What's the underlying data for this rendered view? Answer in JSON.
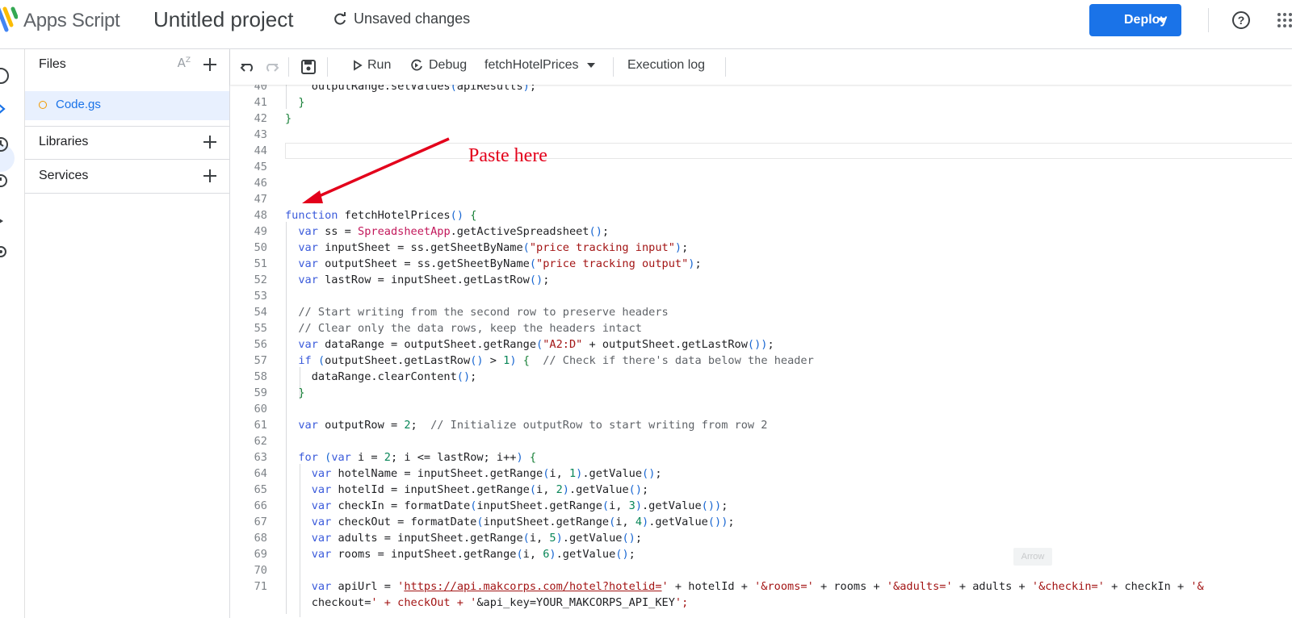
{
  "header": {
    "app_name": "Apps Script",
    "project_title": "Untitled project",
    "save_status": "Unsaved changes",
    "deploy_label": "Deploy",
    "accent_color": "#1a73e8"
  },
  "rail": {
    "icons": [
      "info-icon",
      "code-icon",
      "clock-history-icon",
      "alarm-icon",
      "executions-icon",
      "settings-icon"
    ]
  },
  "files_panel": {
    "files_label": "Files",
    "files": [
      {
        "name": "Code.gs",
        "active": true
      }
    ],
    "libraries_label": "Libraries",
    "services_label": "Services"
  },
  "toolbar": {
    "run_label": "Run",
    "debug_label": "Debug",
    "function_select": "fetchHotelPrices",
    "execution_log_label": "Execution log"
  },
  "annotation": {
    "text": "Paste here",
    "color": "#e3001b"
  },
  "tooltip": "Arrow",
  "editor": {
    "lines": [
      {
        "n": "40",
        "code": "    outputRange.setValues(apiResults);"
      },
      {
        "n": "41",
        "code": "  }"
      },
      {
        "n": "42",
        "code": "}"
      },
      {
        "n": "43",
        "code": ""
      },
      {
        "n": "44",
        "code": ""
      },
      {
        "n": "45",
        "code": ""
      },
      {
        "n": "46",
        "code": ""
      },
      {
        "n": "47",
        "code": ""
      },
      {
        "n": "48",
        "code": "function fetchHotelPrices() {"
      },
      {
        "n": "49",
        "code": "  var ss = SpreadsheetApp.getActiveSpreadsheet();"
      },
      {
        "n": "50",
        "code": "  var inputSheet = ss.getSheetByName(\"price tracking input\");"
      },
      {
        "n": "51",
        "code": "  var outputSheet = ss.getSheetByName(\"price tracking output\");"
      },
      {
        "n": "52",
        "code": "  var lastRow = inputSheet.getLastRow();"
      },
      {
        "n": "53",
        "code": ""
      },
      {
        "n": "54",
        "code": "  // Start writing from the second row to preserve headers"
      },
      {
        "n": "55",
        "code": "  // Clear only the data rows, keep the headers intact"
      },
      {
        "n": "56",
        "code": "  var dataRange = outputSheet.getRange(\"A2:D\" + outputSheet.getLastRow());"
      },
      {
        "n": "57",
        "code": "  if (outputSheet.getLastRow() > 1) {  // Check if there's data below the header"
      },
      {
        "n": "58",
        "code": "    dataRange.clearContent();"
      },
      {
        "n": "59",
        "code": "  }"
      },
      {
        "n": "60",
        "code": ""
      },
      {
        "n": "61",
        "code": "  var outputRow = 2;  // Initialize outputRow to start writing from row 2"
      },
      {
        "n": "62",
        "code": ""
      },
      {
        "n": "63",
        "code": "  for (var i = 2; i <= lastRow; i++) {"
      },
      {
        "n": "64",
        "code": "    var hotelName = inputSheet.getRange(i, 1).getValue();"
      },
      {
        "n": "65",
        "code": "    var hotelId = inputSheet.getRange(i, 2).getValue();"
      },
      {
        "n": "66",
        "code": "    var checkIn = formatDate(inputSheet.getRange(i, 3).getValue());"
      },
      {
        "n": "67",
        "code": "    var checkOut = formatDate(inputSheet.getRange(i, 4).getValue());"
      },
      {
        "n": "68",
        "code": "    var adults = inputSheet.getRange(i, 5).getValue();"
      },
      {
        "n": "69",
        "code": "    var rooms = inputSheet.getRange(i, 6).getValue();"
      },
      {
        "n": "70",
        "code": ""
      },
      {
        "n": "71",
        "code": "    var apiUrl = 'https://api.makcorps.com/hotel?hotelid=' + hotelId + '&rooms=' + rooms + '&adults=' + adults + '&checkin=' + checkIn + '&"
      },
      {
        "n": "",
        "code": "    checkout=' + checkOut + '&api_key=YOUR_MAKCORPS_API_KEY';"
      }
    ]
  }
}
